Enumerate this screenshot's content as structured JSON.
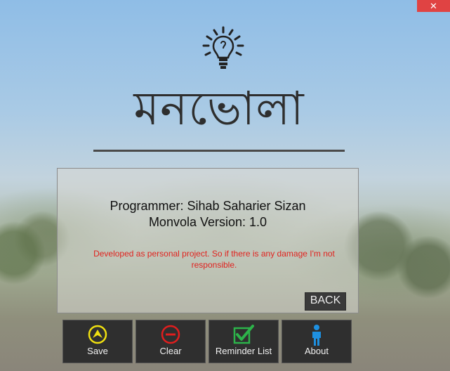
{
  "window": {
    "close_label": "✕"
  },
  "app": {
    "title": "মনভোলা"
  },
  "about": {
    "programmer": "Programmer: Sihab Saharier Sizan",
    "version": "Monvola Version: 1.0",
    "disclaimer": "Developed as personal project. So if there is any damage I'm not responsible.",
    "back_label": "BACK"
  },
  "toolbar": {
    "buttons": [
      {
        "label": "Save",
        "icon": "save-icon",
        "color": "#f0e010"
      },
      {
        "label": "Clear",
        "icon": "clear-icon",
        "color": "#e01e1e"
      },
      {
        "label": "Reminder List",
        "icon": "checklist-icon",
        "color": "#2db34a"
      },
      {
        "label": "About",
        "icon": "person-icon",
        "color": "#1e90e0"
      }
    ]
  }
}
